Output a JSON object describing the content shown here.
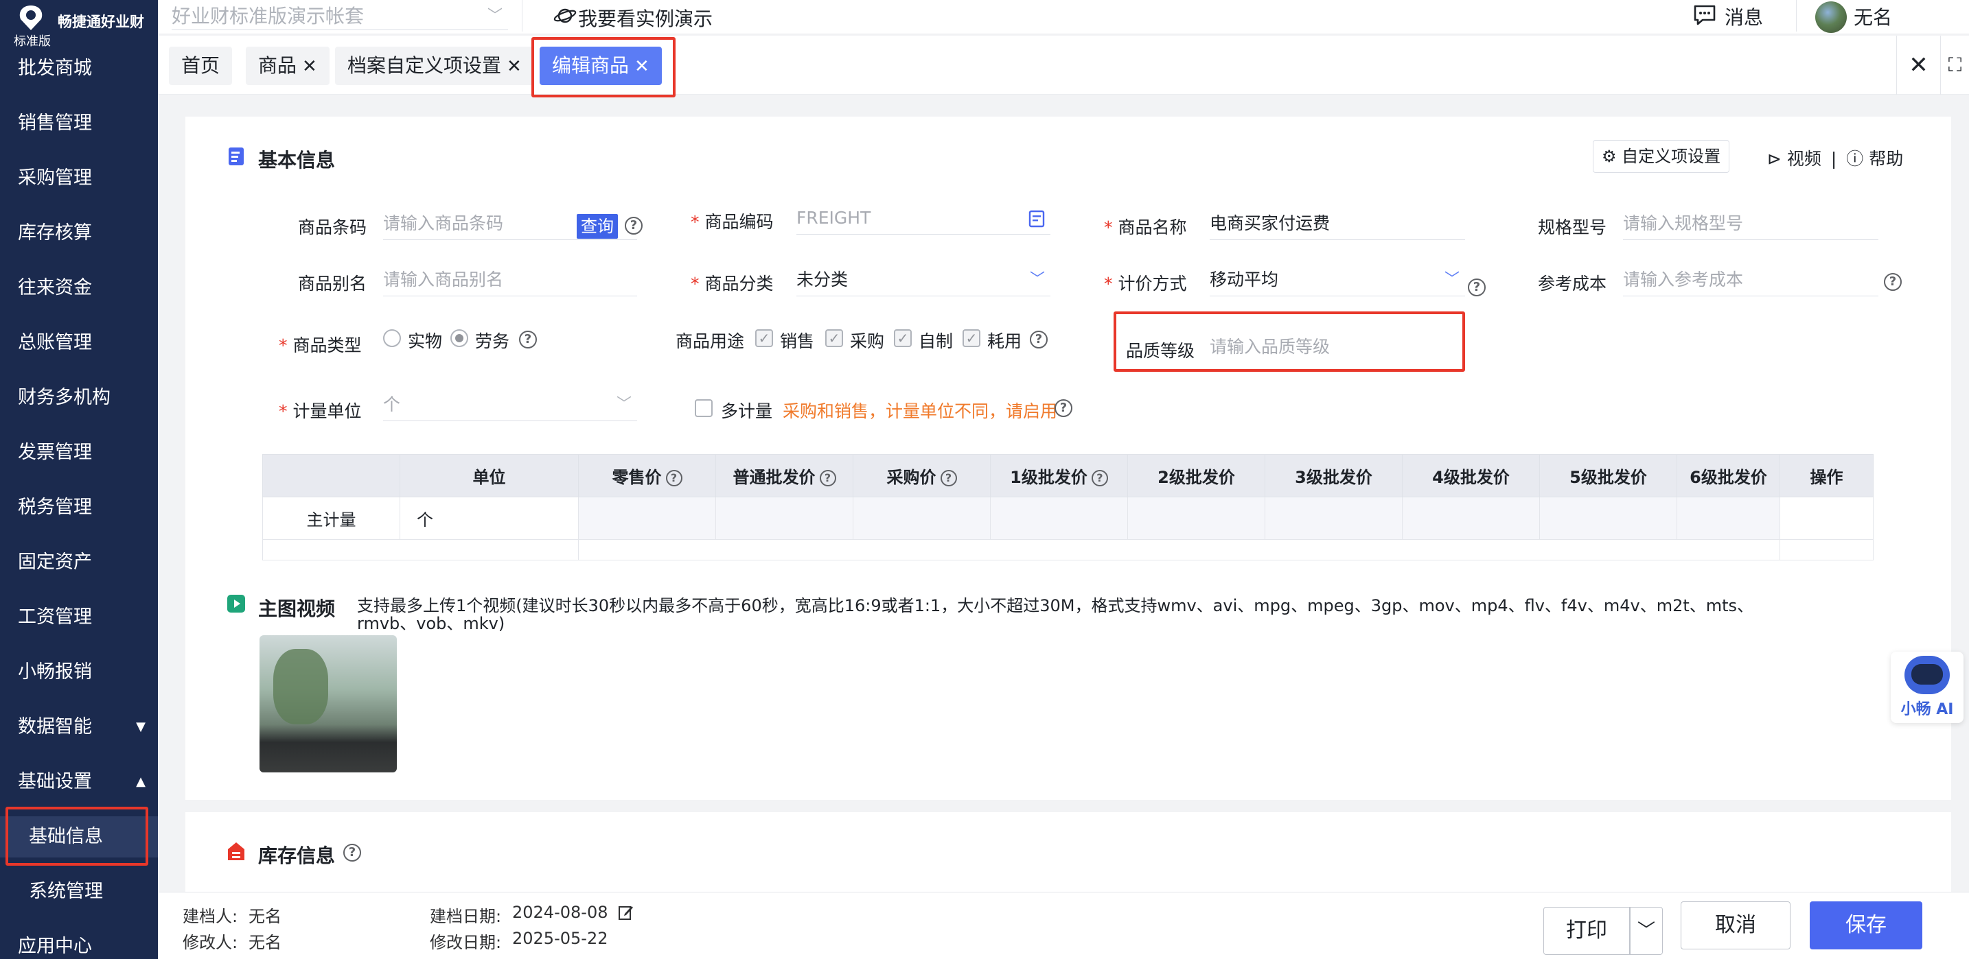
{
  "sidebar": {
    "brand": "畅捷通好业财",
    "edition": "标准版",
    "items": [
      {
        "label": "批发商城"
      },
      {
        "label": "销售管理"
      },
      {
        "label": "采购管理"
      },
      {
        "label": "库存核算"
      },
      {
        "label": "往来资金"
      },
      {
        "label": "总账管理"
      },
      {
        "label": "财务多机构"
      },
      {
        "label": "发票管理"
      },
      {
        "label": "税务管理"
      },
      {
        "label": "固定资产"
      },
      {
        "label": "工资管理"
      },
      {
        "label": "小畅报销"
      },
      {
        "label": "数据智能"
      },
      {
        "label": "基础设置"
      },
      {
        "label": "基础信息"
      },
      {
        "label": "系统管理"
      },
      {
        "label": "应用中心"
      }
    ]
  },
  "topbar": {
    "account_placeholder": "好业财标准版演示帐套",
    "demo_link": "我要看实例演示",
    "messages": "消息",
    "username": "无名"
  },
  "tabs": [
    {
      "label": "首页"
    },
    {
      "label": "商品"
    },
    {
      "label": "档案自定义项设置"
    },
    {
      "label": "编辑商品"
    }
  ],
  "basic": {
    "title": "基本信息",
    "custom_btn": "自定义项设置",
    "video_link": "视频",
    "help_link": "帮助",
    "barcode": {
      "label": "商品条码",
      "placeholder": "请输入商品条码",
      "query": "查询"
    },
    "code": {
      "label": "商品编码",
      "value": "FREIGHT"
    },
    "name": {
      "label": "商品名称",
      "value": "电商买家付运费"
    },
    "spec": {
      "label": "规格型号",
      "placeholder": "请输入规格型号"
    },
    "alias": {
      "label": "商品别名",
      "placeholder": "请输入商品别名"
    },
    "category": {
      "label": "商品分类",
      "value": "未分类"
    },
    "costing": {
      "label": "计价方式",
      "value": "移动平均"
    },
    "refcost": {
      "label": "参考成本",
      "placeholder": "请输入参考成本"
    },
    "type": {
      "label": "商品类型",
      "options": [
        "实物",
        "劳务"
      ],
      "selected": "劳务"
    },
    "usage": {
      "label": "商品用途",
      "options": [
        "销售",
        "采购",
        "自制",
        "耗用"
      ]
    },
    "quality": {
      "label": "品质等级",
      "placeholder": "请输入品质等级"
    },
    "unit": {
      "label": "计量单位",
      "value": "个"
    },
    "multi": {
      "label": "多计量",
      "hint": "采购和销售，计量单位不同，请启用"
    }
  },
  "price_table": {
    "headers": [
      "",
      "单位",
      "零售价",
      "普通批发价",
      "采购价",
      "1级批发价",
      "2级批发价",
      "3级批发价",
      "4级批发价",
      "5级批发价",
      "6级批发价",
      "操作"
    ],
    "row": {
      "label": "主计量",
      "unit": "个"
    }
  },
  "video": {
    "title": "主图视频",
    "desc": "支持最多上传1个视频(建议时长30秒以内最多不高于60秒，宽高比16:9或者1:1，大小不超过30M，格式支持wmv、avi、mpg、mpeg、3gp、mov、mp4、flv、f4v、m4v、m2t、mts、rmvb、vob、mkv)"
  },
  "assistant": {
    "label": "小畅 AI"
  },
  "stock": {
    "title": "库存信息"
  },
  "footer": {
    "creator_label": "建档人:",
    "creator": "无名",
    "modifier_label": "修改人:",
    "modifier": "无名",
    "created_label": "建档日期:",
    "created": "2024-08-08",
    "modified_label": "修改日期:",
    "modified": "2025-05-22",
    "print": "打印",
    "cancel": "取消",
    "save": "保存"
  },
  "colors": {
    "sidebar": "#1b2a4e",
    "accent": "#5b7cf5",
    "primary": "#4a67f0",
    "highlight": "#e8372a",
    "hint": "#f07a2b"
  }
}
